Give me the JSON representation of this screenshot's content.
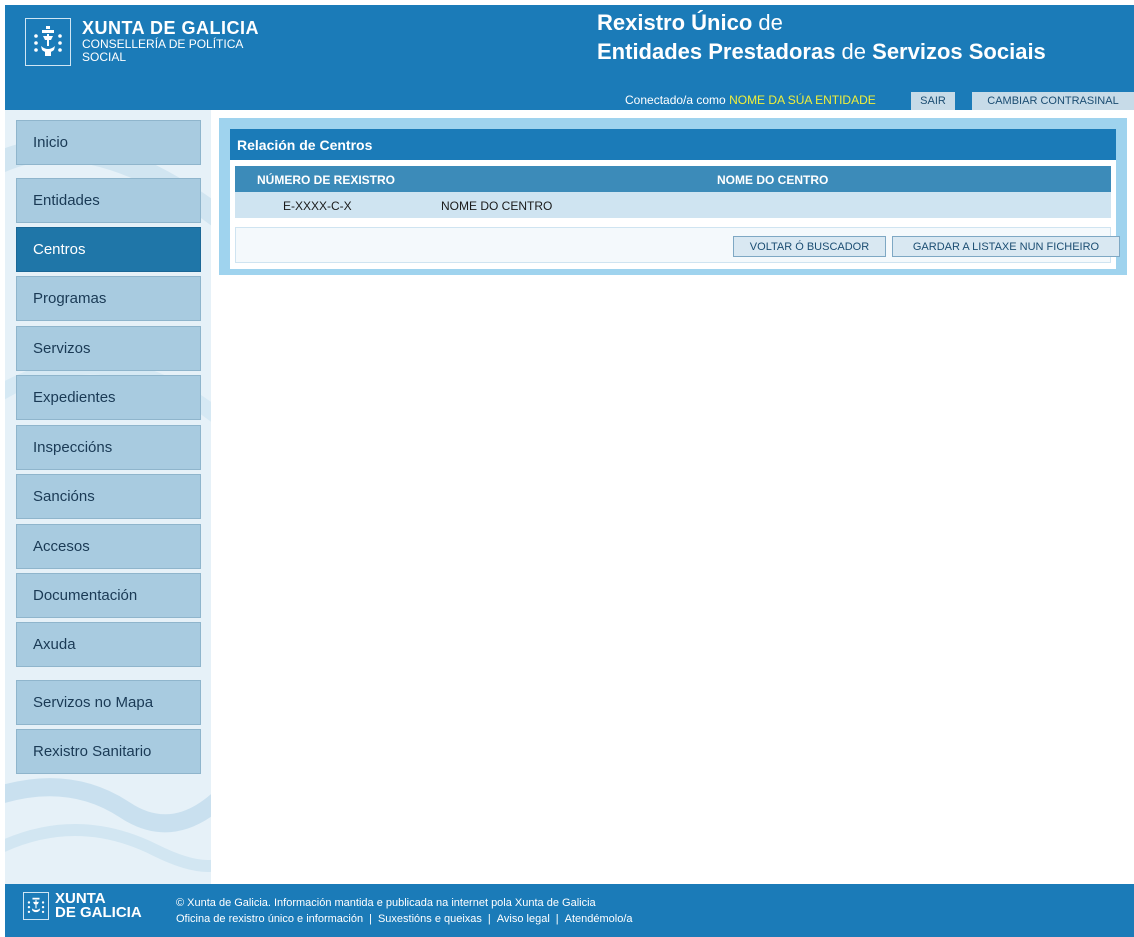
{
  "header": {
    "org_name": "XUNTA DE GALICIA",
    "org_dept_line1": "CONSELLERÍA DE POLÍTICA",
    "org_dept_line2": "SOCIAL",
    "title_line1_bold": "Rexistro Único",
    "title_line1_light": " de",
    "title_line2_a": "Entidades Prestadoras",
    "title_line2_b": " de ",
    "title_line2_c": "Servizos Sociais",
    "connected_label": "Conectado/a como ",
    "entity_name": "NOME DA SÚA ENTIDADE",
    "logout_label": "SAIR",
    "change_password_label": "CAMBIAR CONTRASINAL",
    "entity_color": "#f0ef3a",
    "brand_color": "#1b7bb8"
  },
  "sidebar": {
    "items": [
      {
        "label": "Inicio",
        "active": false
      },
      {
        "label": "Entidades",
        "active": false
      },
      {
        "label": "Centros",
        "active": true
      },
      {
        "label": "Programas",
        "active": false
      },
      {
        "label": "Servizos",
        "active": false
      },
      {
        "label": "Expedientes",
        "active": false
      },
      {
        "label": "Inspeccións",
        "active": false
      },
      {
        "label": "Sancións",
        "active": false
      },
      {
        "label": "Accesos",
        "active": false
      },
      {
        "label": "Documentación",
        "active": false
      },
      {
        "label": "Axuda",
        "active": false
      },
      {
        "label": "Servizos no Mapa",
        "active": false
      },
      {
        "label": "Rexistro Sanitario",
        "active": false
      }
    ]
  },
  "main": {
    "panel_title": "Relación de Centros",
    "columns": [
      "NÚMERO DE REXISTRO",
      "NOME DO CENTRO"
    ],
    "rows": [
      [
        "E-XXXX-C-X",
        "NOME DO CENTRO"
      ]
    ],
    "back_button": "VOLTAR Ó BUSCADOR",
    "save_button": "GARDAR A LISTAXE NUN FICHEIRO"
  },
  "footer": {
    "brand_line1": "XUNTA",
    "brand_line2": "DE GALICIA",
    "copyright": "© Xunta de Galicia. Información mantida e publicada na internet pola Xunta de Galicia",
    "links": [
      "Oficina de rexistro único e información",
      "Suxestións e queixas",
      "Aviso legal",
      "Atendémolo/a"
    ]
  }
}
